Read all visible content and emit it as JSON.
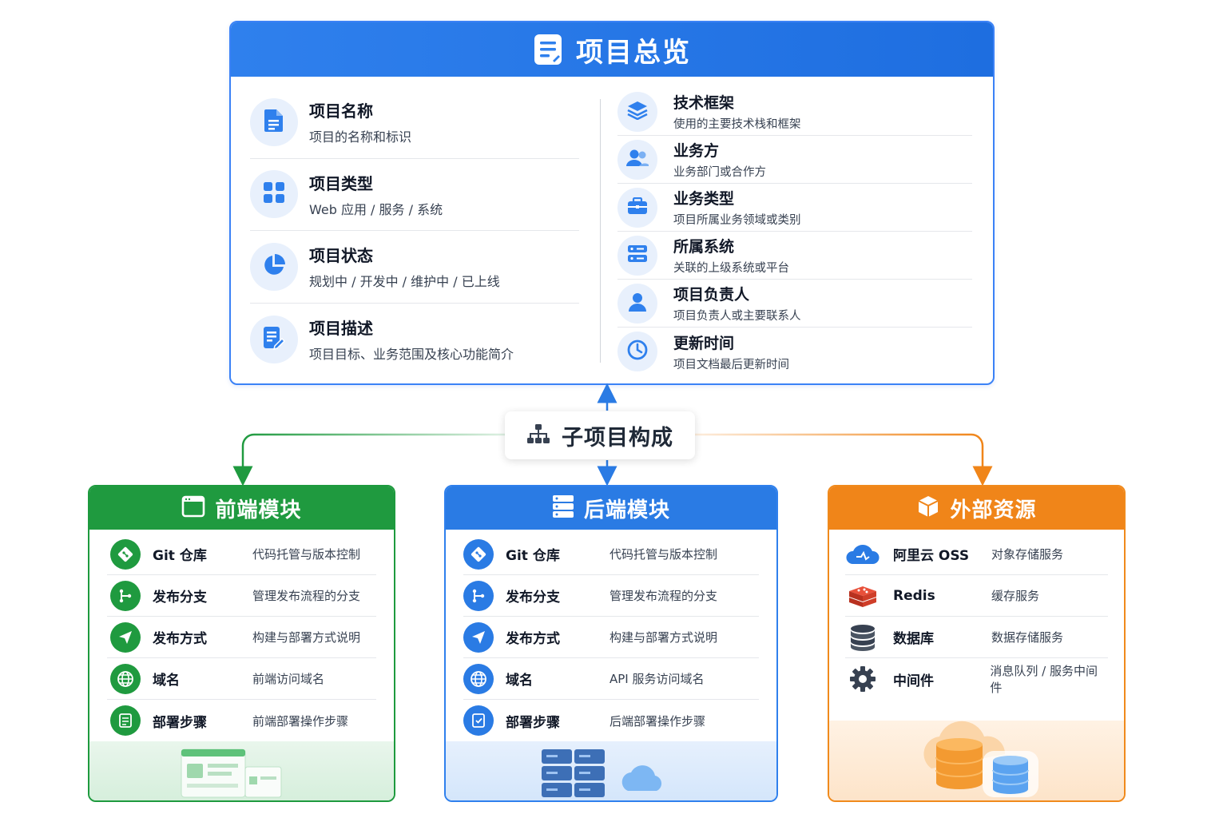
{
  "overview": {
    "title": "项目总览",
    "left_items": [
      {
        "name": "项目名称",
        "desc": "项目的名称和标识",
        "icon": "document-icon"
      },
      {
        "name": "项目类型",
        "desc": "Web 应用 / 服务 / 系统",
        "icon": "grid-icon"
      },
      {
        "name": "项目状态",
        "desc": "规划中 / 开发中 / 维护中 / 已上线",
        "icon": "pie-chart-icon"
      },
      {
        "name": "项目描述",
        "desc": "项目目标、业务范围及核心功能简介",
        "icon": "edit-document-icon"
      }
    ],
    "right_items": [
      {
        "name": "技术框架",
        "desc": "使用的主要技术栈和框架",
        "icon": "layers-icon"
      },
      {
        "name": "业务方",
        "desc": "业务部门或合作方",
        "icon": "users-icon"
      },
      {
        "name": "业务类型",
        "desc": "项目所属业务领域或类别",
        "icon": "briefcase-icon"
      },
      {
        "name": "所属系统",
        "desc": "关联的上级系统或平台",
        "icon": "server-icon"
      },
      {
        "name": "项目负责人",
        "desc": "项目负责人或主要联系人",
        "icon": "person-icon"
      },
      {
        "name": "更新时间",
        "desc": "项目文档最后更新时间",
        "icon": "clock-icon"
      }
    ]
  },
  "sub_projects": {
    "label": "子项目构成",
    "icon": "hierarchy-icon"
  },
  "modules": {
    "frontend": {
      "title": "前端模块",
      "rows": [
        {
          "name": "Git 仓库",
          "desc": "代码托管与版本控制",
          "icon": "git-icon"
        },
        {
          "name": "发布分支",
          "desc": "管理发布流程的分支",
          "icon": "branch-icon"
        },
        {
          "name": "发布方式",
          "desc": "构建与部署方式说明",
          "icon": "send-icon"
        },
        {
          "name": "域名",
          "desc": "前端访问域名",
          "icon": "globe-icon"
        },
        {
          "name": "部署步骤",
          "desc": "前端部署操作步骤",
          "icon": "checklist-icon"
        }
      ]
    },
    "backend": {
      "title": "后端模块",
      "rows": [
        {
          "name": "Git 仓库",
          "desc": "代码托管与版本控制",
          "icon": "git-icon"
        },
        {
          "name": "发布分支",
          "desc": "管理发布流程的分支",
          "icon": "branch-icon"
        },
        {
          "name": "发布方式",
          "desc": "构建与部署方式说明",
          "icon": "send-icon"
        },
        {
          "name": "域名",
          "desc": "API 服务访问域名",
          "icon": "globe-icon"
        },
        {
          "name": "部署步骤",
          "desc": "后端部署操作步骤",
          "icon": "checklist-icon"
        }
      ]
    },
    "external": {
      "title": "外部资源",
      "rows": [
        {
          "name": "阿里云 OSS",
          "desc": "对象存储服务",
          "icon": "cloud-icon"
        },
        {
          "name": "Redis",
          "desc": "缓存服务",
          "icon": "redis-icon"
        },
        {
          "name": "数据库",
          "desc": "数据存储服务",
          "icon": "database-icon"
        },
        {
          "name": "中间件",
          "desc": "消息队列 / 服务中间件",
          "icon": "gear-icon"
        }
      ]
    }
  },
  "colors": {
    "overview": "#2f80ed",
    "frontend": "#1f9a3f",
    "backend": "#2a7be4",
    "external": "#f08519"
  }
}
